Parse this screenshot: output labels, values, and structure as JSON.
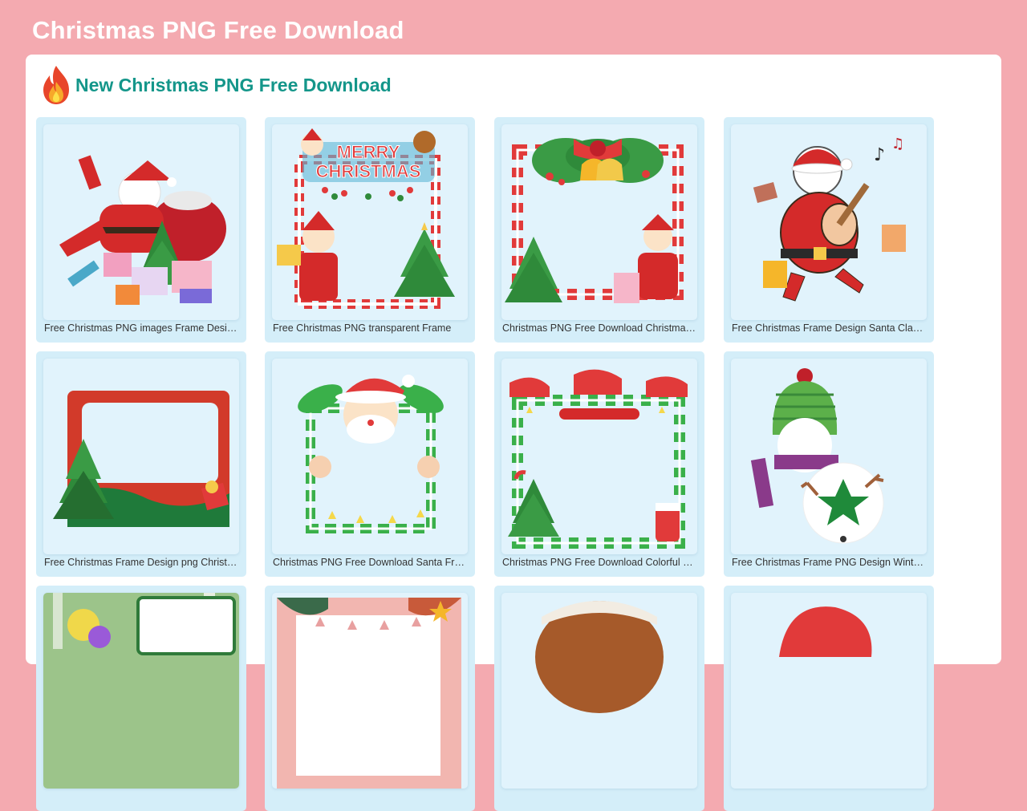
{
  "page": {
    "title": "Christmas PNG Free Download"
  },
  "section": {
    "title": "New Christmas PNG Free Download",
    "icon": "flame-icon"
  },
  "colors": {
    "background": "#f4aab0",
    "accent": "#14968a",
    "card": "#d4eef9"
  },
  "cards": [
    {
      "caption": "Free Christmas PNG images Frame Design Santa Claus",
      "icon": "santa-gifts-image"
    },
    {
      "caption": "Free Christmas PNG transparent Frame",
      "icon": "merry-christmas-frame-image"
    },
    {
      "caption": "Christmas PNG Free Download Christmas Bell Frame",
      "icon": "bell-frame-image"
    },
    {
      "caption": "Free Christmas Frame Design Santa Claus Guitar",
      "icon": "santa-guitar-image"
    },
    {
      "caption": "Free Christmas Frame Design png Christmas Tree",
      "icon": "red-frame-tree-image"
    },
    {
      "caption": "Christmas PNG Free Download Santa Frame",
      "icon": "santa-green-frame-image"
    },
    {
      "caption": "Christmas PNG Free Download Colorful Frame",
      "icon": "candy-cane-frame-image"
    },
    {
      "caption": "Free Christmas Frame PNG Design Winter Snowman",
      "icon": "snowman-image"
    },
    {
      "caption": "",
      "icon": "forest-frame-image"
    },
    {
      "caption": "",
      "icon": "banner-frame-image"
    },
    {
      "caption": "",
      "icon": "dome-image"
    },
    {
      "caption": "",
      "icon": "santa-hat-image"
    }
  ]
}
